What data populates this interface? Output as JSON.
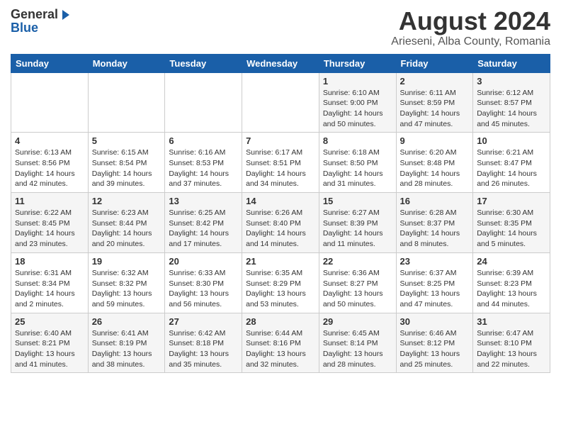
{
  "logo": {
    "general": "General",
    "blue": "Blue",
    "arrow_icon": "▶"
  },
  "title": "August 2024",
  "subtitle": "Arieseni, Alba County, Romania",
  "days_of_week": [
    "Sunday",
    "Monday",
    "Tuesday",
    "Wednesday",
    "Thursday",
    "Friday",
    "Saturday"
  ],
  "weeks": [
    [
      {
        "date": "",
        "info": ""
      },
      {
        "date": "",
        "info": ""
      },
      {
        "date": "",
        "info": ""
      },
      {
        "date": "",
        "info": ""
      },
      {
        "date": "1",
        "info": "Sunrise: 6:10 AM\nSunset: 9:00 PM\nDaylight: 14 hours\nand 50 minutes."
      },
      {
        "date": "2",
        "info": "Sunrise: 6:11 AM\nSunset: 8:59 PM\nDaylight: 14 hours\nand 47 minutes."
      },
      {
        "date": "3",
        "info": "Sunrise: 6:12 AM\nSunset: 8:57 PM\nDaylight: 14 hours\nand 45 minutes."
      }
    ],
    [
      {
        "date": "4",
        "info": "Sunrise: 6:13 AM\nSunset: 8:56 PM\nDaylight: 14 hours\nand 42 minutes."
      },
      {
        "date": "5",
        "info": "Sunrise: 6:15 AM\nSunset: 8:54 PM\nDaylight: 14 hours\nand 39 minutes."
      },
      {
        "date": "6",
        "info": "Sunrise: 6:16 AM\nSunset: 8:53 PM\nDaylight: 14 hours\nand 37 minutes."
      },
      {
        "date": "7",
        "info": "Sunrise: 6:17 AM\nSunset: 8:51 PM\nDaylight: 14 hours\nand 34 minutes."
      },
      {
        "date": "8",
        "info": "Sunrise: 6:18 AM\nSunset: 8:50 PM\nDaylight: 14 hours\nand 31 minutes."
      },
      {
        "date": "9",
        "info": "Sunrise: 6:20 AM\nSunset: 8:48 PM\nDaylight: 14 hours\nand 28 minutes."
      },
      {
        "date": "10",
        "info": "Sunrise: 6:21 AM\nSunset: 8:47 PM\nDaylight: 14 hours\nand 26 minutes."
      }
    ],
    [
      {
        "date": "11",
        "info": "Sunrise: 6:22 AM\nSunset: 8:45 PM\nDaylight: 14 hours\nand 23 minutes."
      },
      {
        "date": "12",
        "info": "Sunrise: 6:23 AM\nSunset: 8:44 PM\nDaylight: 14 hours\nand 20 minutes."
      },
      {
        "date": "13",
        "info": "Sunrise: 6:25 AM\nSunset: 8:42 PM\nDaylight: 14 hours\nand 17 minutes."
      },
      {
        "date": "14",
        "info": "Sunrise: 6:26 AM\nSunset: 8:40 PM\nDaylight: 14 hours\nand 14 minutes."
      },
      {
        "date": "15",
        "info": "Sunrise: 6:27 AM\nSunset: 8:39 PM\nDaylight: 14 hours\nand 11 minutes."
      },
      {
        "date": "16",
        "info": "Sunrise: 6:28 AM\nSunset: 8:37 PM\nDaylight: 14 hours\nand 8 minutes."
      },
      {
        "date": "17",
        "info": "Sunrise: 6:30 AM\nSunset: 8:35 PM\nDaylight: 14 hours\nand 5 minutes."
      }
    ],
    [
      {
        "date": "18",
        "info": "Sunrise: 6:31 AM\nSunset: 8:34 PM\nDaylight: 14 hours\nand 2 minutes."
      },
      {
        "date": "19",
        "info": "Sunrise: 6:32 AM\nSunset: 8:32 PM\nDaylight: 13 hours\nand 59 minutes."
      },
      {
        "date": "20",
        "info": "Sunrise: 6:33 AM\nSunset: 8:30 PM\nDaylight: 13 hours\nand 56 minutes."
      },
      {
        "date": "21",
        "info": "Sunrise: 6:35 AM\nSunset: 8:29 PM\nDaylight: 13 hours\nand 53 minutes."
      },
      {
        "date": "22",
        "info": "Sunrise: 6:36 AM\nSunset: 8:27 PM\nDaylight: 13 hours\nand 50 minutes."
      },
      {
        "date": "23",
        "info": "Sunrise: 6:37 AM\nSunset: 8:25 PM\nDaylight: 13 hours\nand 47 minutes."
      },
      {
        "date": "24",
        "info": "Sunrise: 6:39 AM\nSunset: 8:23 PM\nDaylight: 13 hours\nand 44 minutes."
      }
    ],
    [
      {
        "date": "25",
        "info": "Sunrise: 6:40 AM\nSunset: 8:21 PM\nDaylight: 13 hours\nand 41 minutes."
      },
      {
        "date": "26",
        "info": "Sunrise: 6:41 AM\nSunset: 8:19 PM\nDaylight: 13 hours\nand 38 minutes."
      },
      {
        "date": "27",
        "info": "Sunrise: 6:42 AM\nSunset: 8:18 PM\nDaylight: 13 hours\nand 35 minutes."
      },
      {
        "date": "28",
        "info": "Sunrise: 6:44 AM\nSunset: 8:16 PM\nDaylight: 13 hours\nand 32 minutes."
      },
      {
        "date": "29",
        "info": "Sunrise: 6:45 AM\nSunset: 8:14 PM\nDaylight: 13 hours\nand 28 minutes."
      },
      {
        "date": "30",
        "info": "Sunrise: 6:46 AM\nSunset: 8:12 PM\nDaylight: 13 hours\nand 25 minutes."
      },
      {
        "date": "31",
        "info": "Sunrise: 6:47 AM\nSunset: 8:10 PM\nDaylight: 13 hours\nand 22 minutes."
      }
    ]
  ]
}
